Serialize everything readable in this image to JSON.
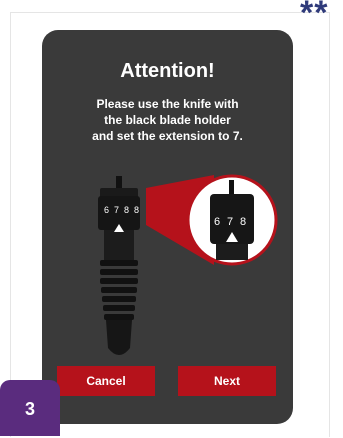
{
  "corner_mark": "**",
  "dialog": {
    "title": "Attention!",
    "message_lines": [
      "Please use the knife with",
      "the black blade holder",
      "and set the extension to 7."
    ],
    "knob_marks_main": [
      "6",
      "7",
      "8",
      "8"
    ],
    "knob_marks_zoom": [
      "6",
      "7",
      "8"
    ],
    "cancel_label": "Cancel",
    "next_label": "Next"
  },
  "step_badge": "3",
  "colors": {
    "dialog_bg": "#3a3a3a",
    "button_red": "#b5121b",
    "badge_purple": "#5a2c7e",
    "corner_mark": "#2f3a7a"
  }
}
